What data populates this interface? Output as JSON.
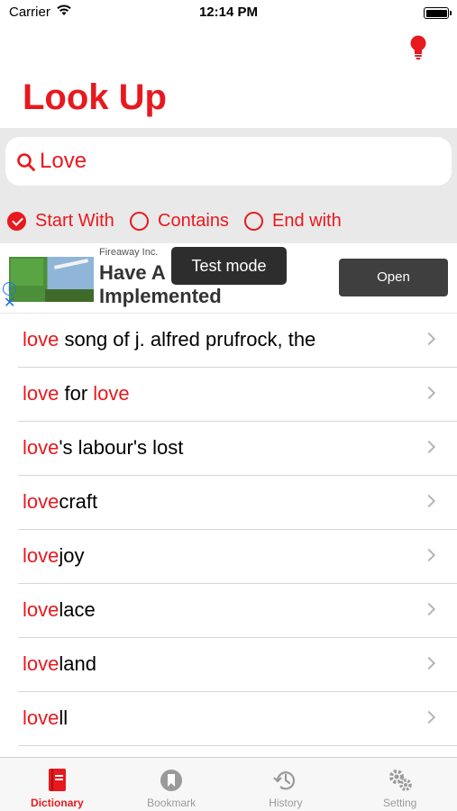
{
  "status_bar": {
    "carrier": "Carrier",
    "time": "12:14 PM"
  },
  "header": {
    "title": "Look Up",
    "hint_icon": "lightbulb-icon"
  },
  "search": {
    "value": "Love",
    "placeholder": ""
  },
  "match_modes": [
    {
      "label": "Start With",
      "selected": true
    },
    {
      "label": "Contains",
      "selected": false
    },
    {
      "label": "End with",
      "selected": false
    }
  ],
  "ad": {
    "advertiser": "Fireaway Inc.",
    "headline": "Have A",
    "headline_line2": "Implemented",
    "cta": "Open",
    "badge": "Test mode",
    "info_glyph": "i",
    "close_glyph": "✕"
  },
  "results": [
    {
      "match": "love",
      "rest": " song of j. alfred prufrock, the"
    },
    {
      "match": "love",
      "middle": " for ",
      "match2": "love"
    },
    {
      "match": "love",
      "rest": "'s labour's lost"
    },
    {
      "match": "love",
      "rest": "craft"
    },
    {
      "match": "love",
      "rest": "joy"
    },
    {
      "match": "love",
      "rest": "lace"
    },
    {
      "match": "love",
      "rest": "land"
    },
    {
      "match": "love",
      "rest": "ll"
    }
  ],
  "tabs": [
    {
      "label": "Dictionary",
      "icon": "book-icon",
      "active": true
    },
    {
      "label": "Bookmark",
      "icon": "bookmark-icon",
      "active": false
    },
    {
      "label": "History",
      "icon": "history-icon",
      "active": false
    },
    {
      "label": "Setting",
      "icon": "gears-icon",
      "active": false
    }
  ],
  "colors": {
    "accent": "#e8191e",
    "inactive": "#9a9a9a",
    "panel": "#e9e9e9"
  }
}
